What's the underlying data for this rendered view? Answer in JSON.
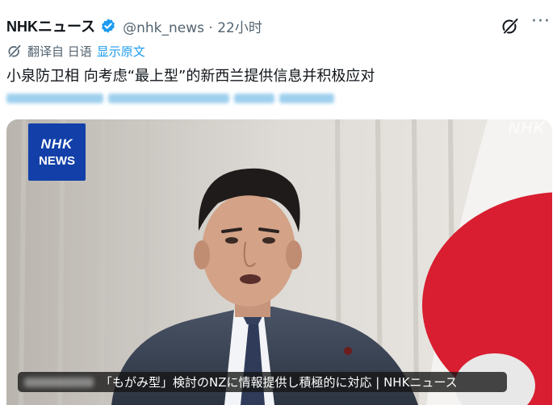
{
  "header": {
    "display_name": "NHKニュース",
    "handle": "@nhk_news",
    "separator": "·",
    "time": "22小时",
    "more_label": "···",
    "verified_color": "#1d9bf0"
  },
  "translation": {
    "label": "翻译自 日语",
    "show_original": "显示原文"
  },
  "post": {
    "text": "小泉防卫相 向考虑“最上型”的新西兰提供信息并积极应对"
  },
  "media": {
    "logo_line1": "NHK",
    "logo_line2": "NEWS",
    "watermark": "NHK",
    "caption": "「もがみ型」検討のNZに情報提供し積極的に対応 | NHKニュース"
  },
  "colors": {
    "accent": "#1d9bf0",
    "nhk_blue": "#1240a8",
    "flag_red": "#d81e30"
  }
}
